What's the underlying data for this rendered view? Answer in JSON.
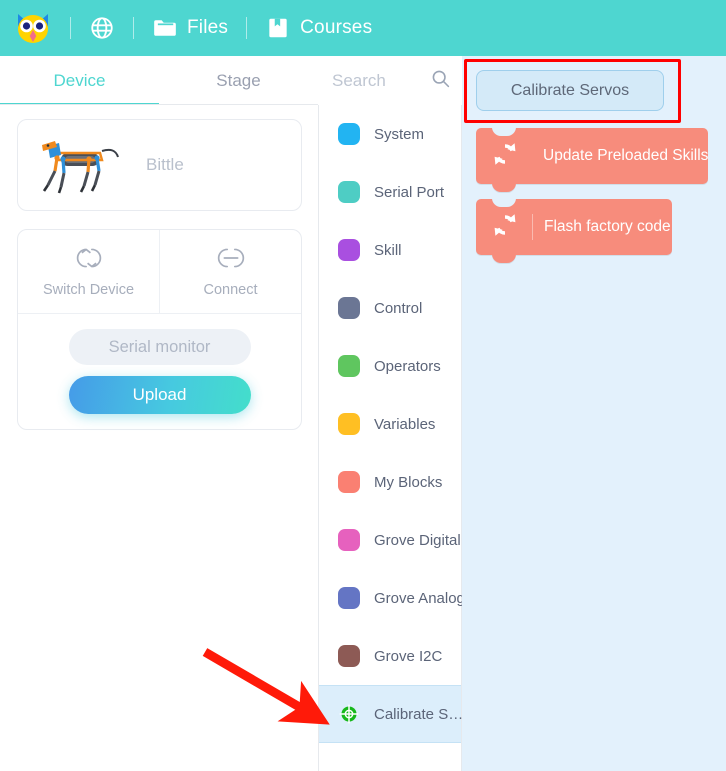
{
  "topbar": {
    "logo_icon": "owl-logo-icon",
    "globe_icon": "globe-icon",
    "files_icon": "folder-icon",
    "files_label": "Files",
    "courses_icon": "book-icon",
    "courses_label": "Courses",
    "background_color": "#4ED6D0"
  },
  "tabs": [
    {
      "label": "Device",
      "active": true
    },
    {
      "label": "Stage",
      "active": false
    }
  ],
  "search": {
    "value": "",
    "placeholder": "Search",
    "icon": "search-icon"
  },
  "device_card": {
    "image_icon": "bittle-robot-dog-image",
    "name": "Bittle"
  },
  "actions": {
    "switch_device_icon": "switch-device-icon",
    "switch_device_label": "Switch Device",
    "connect_icon": "link-icon",
    "connect_label": "Connect",
    "serial_monitor_label": "Serial monitor",
    "upload_label": "Upload",
    "upload_gradient_start": "#459BE8",
    "upload_gradient_end": "#44DECB"
  },
  "categories": [
    {
      "label": "System",
      "color": "#22B4F2",
      "icon": "color-dot",
      "selected": false
    },
    {
      "label": "Serial Port",
      "color": "#4ECDC4",
      "icon": "color-dot",
      "selected": false
    },
    {
      "label": "Skill",
      "color": "#A94FE0",
      "icon": "color-dot",
      "selected": false
    },
    {
      "label": "Control",
      "color": "#6B7694",
      "icon": "color-dot",
      "selected": false
    },
    {
      "label": "Operators",
      "color": "#5FC65F",
      "icon": "color-dot",
      "selected": false
    },
    {
      "label": "Variables",
      "color": "#FFBF23",
      "icon": "color-dot",
      "selected": false
    },
    {
      "label": "My Blocks",
      "color": "#FA8072",
      "icon": "color-dot",
      "selected": false
    },
    {
      "label": "Grove Digital",
      "color": "#E661BE",
      "icon": "color-dot",
      "selected": false
    },
    {
      "label": "Grove Analog",
      "color": "#6475C4",
      "icon": "color-dot",
      "selected": false
    },
    {
      "label": "Grove I2C",
      "color": "#8D5A55",
      "icon": "color-dot",
      "selected": false
    },
    {
      "label": "Calibrate S…",
      "color": "#18B81B",
      "icon": "calibrate-globe-icon",
      "selected": true
    }
  ],
  "workspace": {
    "background_color": "#E3F1FC",
    "header_pill_label": "Calibrate Servos",
    "highlight_color": "#FF0000",
    "blocks": [
      {
        "label": "Update Preloaded Skills",
        "icon": "refresh-sync-icon",
        "color": "#F78C7C"
      },
      {
        "label": "Flash factory code",
        "icon": "refresh-sync-icon",
        "color": "#F78C7C"
      }
    ]
  },
  "annotation": {
    "arrow_color": "#FF1A09",
    "arrow_from": "205,652",
    "arrow_to": "318,718"
  }
}
